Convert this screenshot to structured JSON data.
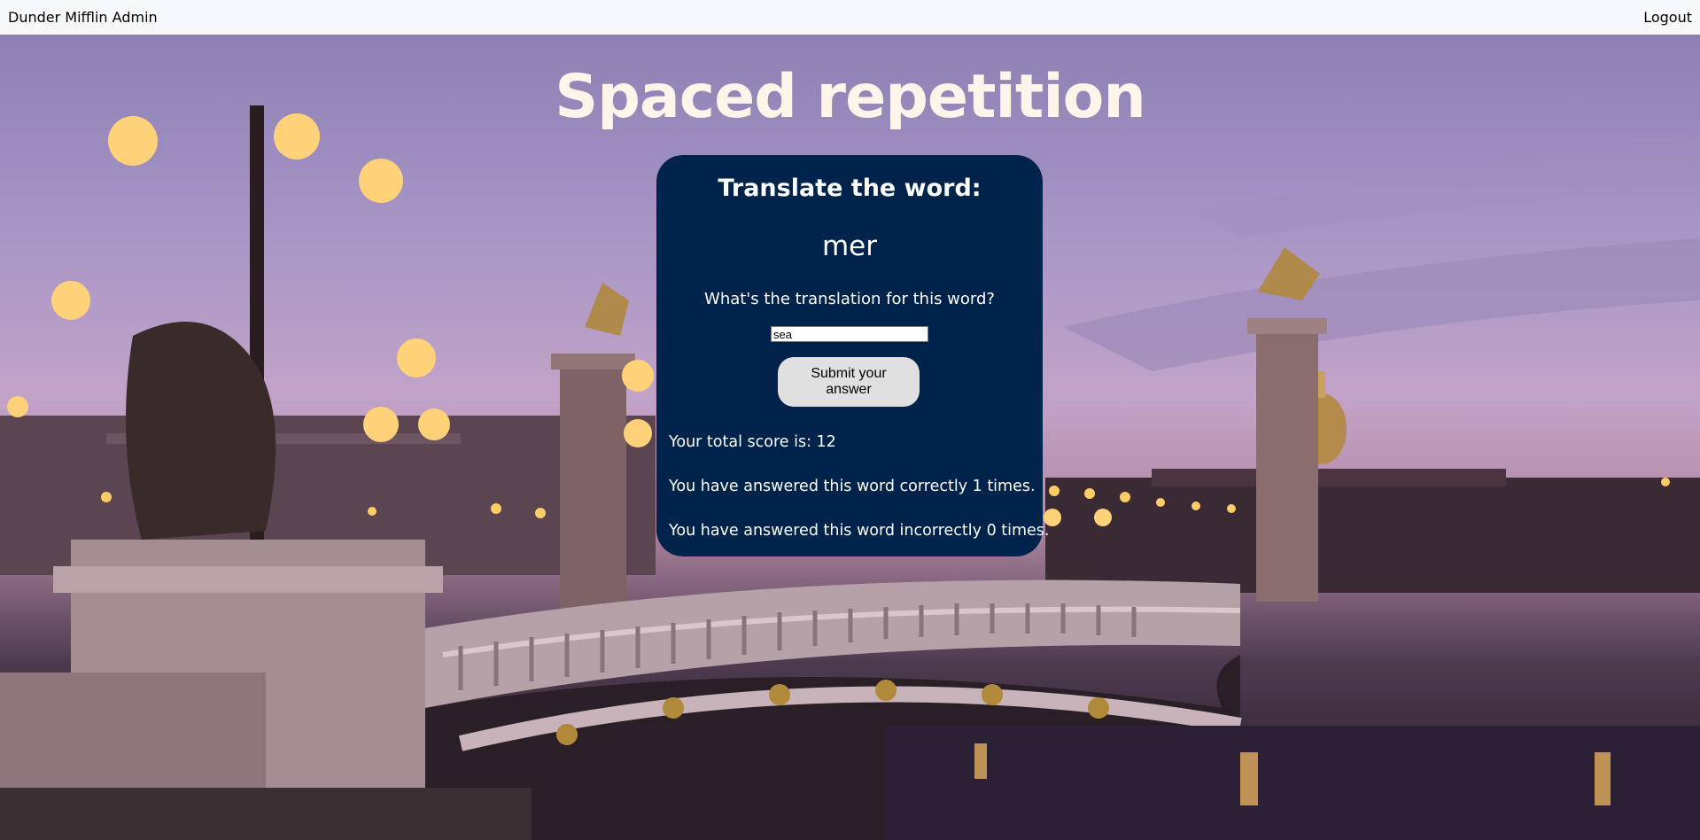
{
  "header": {
    "brand": "Dunder Mifflin Admin",
    "logout": "Logout"
  },
  "page": {
    "title": "Spaced repetition"
  },
  "card": {
    "heading": "Translate the word:",
    "word": "mer",
    "question": "What's the translation for this word?",
    "answer_value": "sea",
    "submit_label": "Submit your answer",
    "total_score": "Your total score is: 12",
    "correct_count": "You have answered this word correctly 1 times.",
    "incorrect_count": "You have answered this word incorrectly 0 times."
  },
  "colors": {
    "card_bg": "#00234b",
    "header_bg": "#f7f8fc",
    "title_text": "#fdf4ea"
  }
}
